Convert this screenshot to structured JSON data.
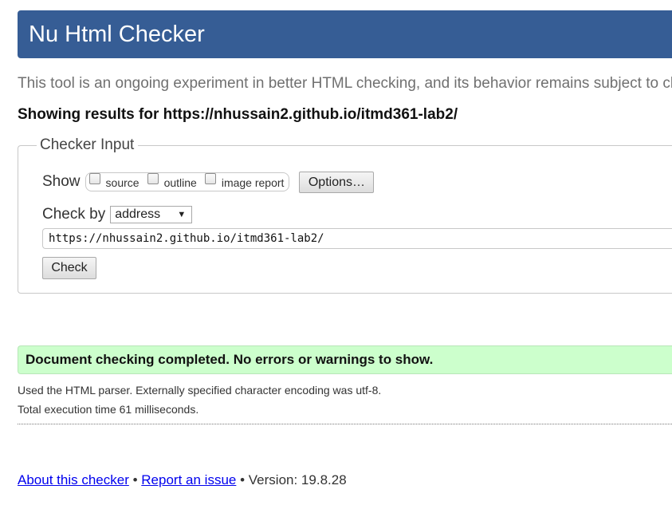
{
  "header": {
    "title": "Nu Html Checker"
  },
  "intro": {
    "text": "This tool is an ongoing experiment in better HTML checking, and its behavior remains subject to change"
  },
  "results": {
    "heading": "Showing results for https://nhussain2.github.io/itmd361-lab2/"
  },
  "checker_input": {
    "legend": "Checker Input",
    "show_label": "Show",
    "show_options": [
      {
        "label": "source",
        "checked": false
      },
      {
        "label": "outline",
        "checked": false
      },
      {
        "label": "image report",
        "checked": false
      }
    ],
    "options_button": "Options…",
    "check_by_label": "Check by",
    "check_by_selected": "address",
    "url_value": "https://nhussain2.github.io/itmd361-lab2/",
    "check_button": "Check"
  },
  "outcome": {
    "message": "Document checking completed. No errors or warnings to show.",
    "parser_line": "Used the HTML parser. Externally specified character encoding was utf-8.",
    "time_line": "Total execution time 61 milliseconds."
  },
  "footer": {
    "about_link": "About this checker",
    "separator": "•",
    "report_link": "Report an issue",
    "version": "Version: 19.8.28"
  },
  "colors": {
    "header_bg": "#365d95",
    "success_bg": "#ccffcc",
    "link": "#0000ee"
  }
}
